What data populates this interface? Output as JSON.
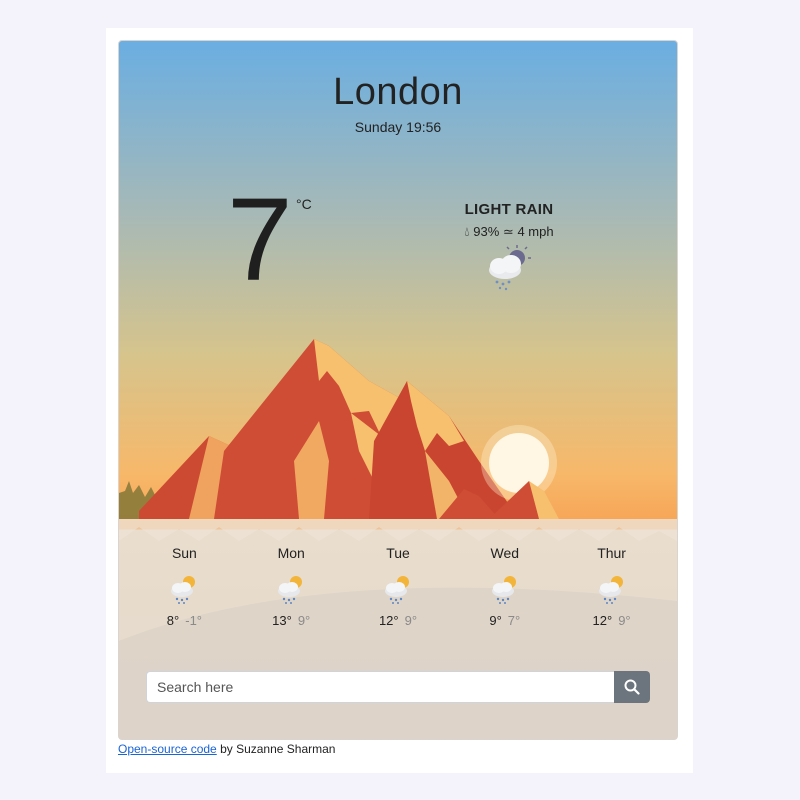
{
  "weather": {
    "city": "London",
    "datetime": "Sunday 19:56",
    "temperature": "7",
    "unit": "°C",
    "description": "LIGHT RAIN",
    "humidity": "93%",
    "wind": "4 mph",
    "icon": "rain-cloud-moon-icon"
  },
  "forecast": [
    {
      "day": "Sun",
      "max": "8°",
      "min": "-1°",
      "icon": "rain-cloud-sun-icon"
    },
    {
      "day": "Mon",
      "max": "13°",
      "min": "9°",
      "icon": "rain-cloud-sun-icon"
    },
    {
      "day": "Tue",
      "max": "12°",
      "min": "9°",
      "icon": "rain-cloud-sun-icon"
    },
    {
      "day": "Wed",
      "max": "9°",
      "min": "7°",
      "icon": "rain-cloud-sun-icon"
    },
    {
      "day": "Thur",
      "max": "12°",
      "min": "9°",
      "icon": "rain-cloud-sun-icon"
    }
  ],
  "search": {
    "placeholder": "Search here",
    "value": ""
  },
  "footer": {
    "link_text": "Open-source code",
    "credit": " by Suzanne Sharman"
  },
  "colors": {
    "sky_top": "#6aaee2",
    "sky_bottom": "#f7a253",
    "mountain": "#d5503a",
    "button": "#6c757d",
    "link": "#1a64d6"
  }
}
